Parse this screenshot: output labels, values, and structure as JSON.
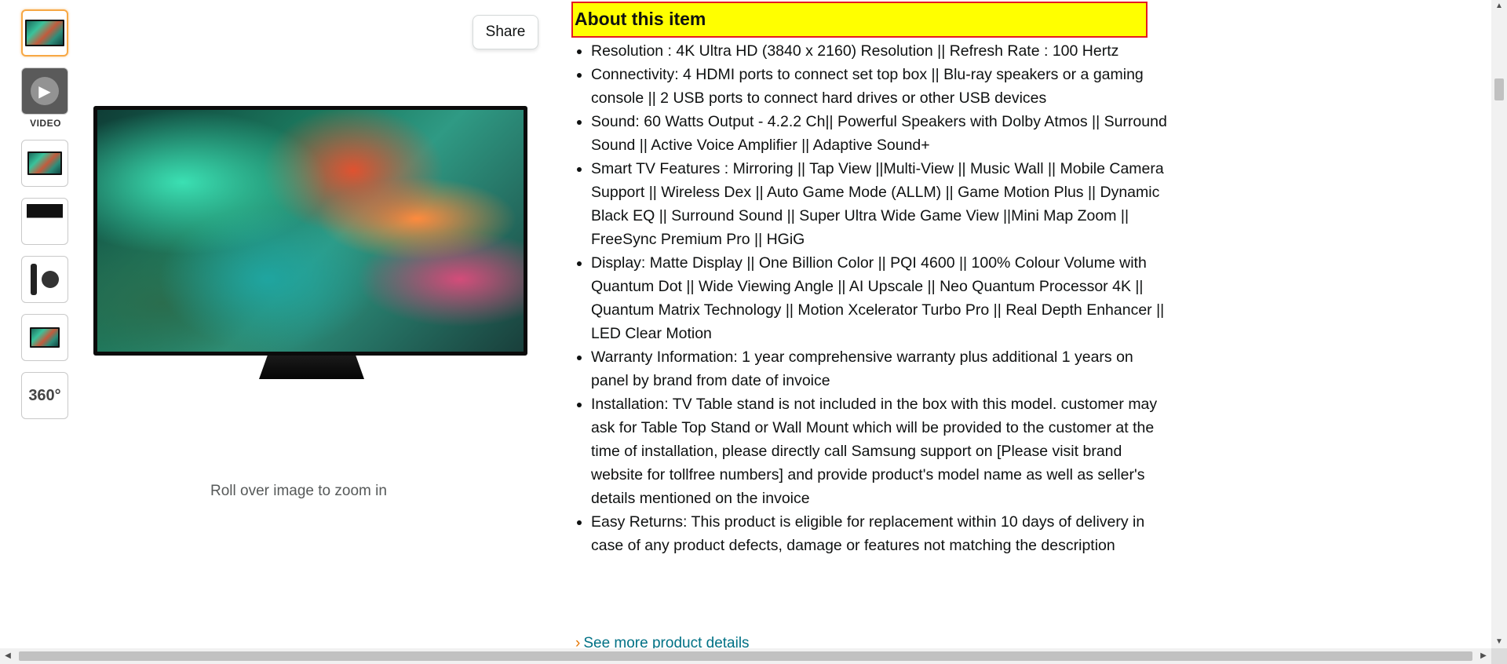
{
  "gallery": {
    "thumbnails": [
      {
        "kind": "tv-image",
        "selected": true
      },
      {
        "kind": "video",
        "selected": false,
        "label": "VIDEO"
      },
      {
        "kind": "infographic",
        "selected": false
      },
      {
        "kind": "feature-grid",
        "selected": false
      },
      {
        "kind": "remote-accessories",
        "selected": false
      },
      {
        "kind": "tv-side-view",
        "selected": false
      },
      {
        "kind": "view-360",
        "selected": false,
        "label": "360°"
      }
    ],
    "video_label": "VIDEO",
    "view_360_label": "360°",
    "share_label": "Share",
    "zoom_hint": "Roll over image to zoom in"
  },
  "about": {
    "heading": "About this item",
    "highlight_color": "#ffff00",
    "border_color": "#e51b23",
    "bullets": [
      "Resolution : 4K Ultra HD (3840 x 2160) Resolution || Refresh Rate : 100 Hertz",
      "Connectivity: 4 HDMI ports to connect set top box || Blu-ray speakers or a gaming console || 2 USB ports to connect hard drives or other USB devices",
      "Sound: 60 Watts Output - 4.2.2 Ch|| Powerful Speakers with Dolby Atmos || Surround Sound || Active Voice Amplifier || Adaptive Sound+",
      "Smart TV Features : Mirroring || Tap View ||Multi-View || Music Wall || Mobile Camera Support || Wireless Dex || Auto Game Mode (ALLM) || Game Motion Plus || Dynamic Black EQ || Surround Sound || Super Ultra Wide Game View ||Mini Map Zoom || FreeSync Premium Pro || HGiG",
      "Display: Matte Display || One Billion Color || PQI 4600 || 100% Colour Volume with Quantum Dot || Wide Viewing Angle || AI Upscale || Neo Quantum Processor 4K || Quantum Matrix Technology || Motion Xcelerator Turbo Pro || Real Depth Enhancer || LED Clear Motion",
      "Warranty Information: 1 year comprehensive warranty plus additional 1 years on panel by brand from date of invoice",
      "Installation: TV Table stand is not included in the box with this model. customer may ask for Table Top Stand or Wall Mount which will be provided to the customer at the time of installation, please directly call Samsung support on [Please visit brand website for tollfree numbers] and provide product's model name as well as seller's details mentioned on the invoice",
      "Easy Returns: This product is eligible for replacement within 10 days of delivery in case of any product defects, damage or features not matching the description"
    ],
    "see_more_label": "See more product details"
  },
  "colors": {
    "link": "#007185",
    "selected_thumb_border": "#f7a845",
    "secondary_text": "#565959"
  }
}
